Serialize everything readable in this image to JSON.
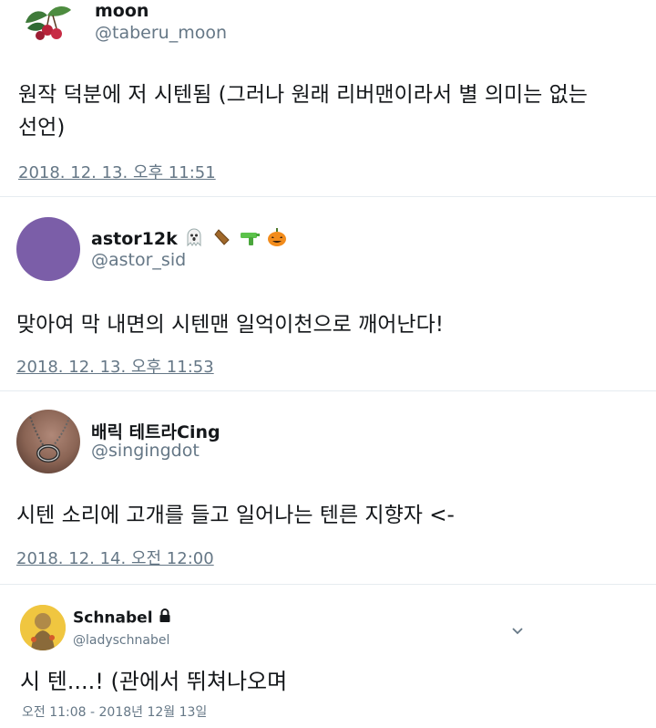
{
  "tweets": [
    {
      "name": "moon",
      "handle": "@taberu_moon",
      "text_line1": "원작 덕분에 저 시텐됨 (그러나 원래 리버맨이라서 별 의미는 없는",
      "text_line2": "선언)",
      "time": "2018. 12. 13. 오후 11:51",
      "avatar_icon": "cherry-leaf-icon"
    },
    {
      "name": "astor12k",
      "handle": "@astor_sid",
      "name_emojis": [
        "ghost-icon",
        "coffin-icon",
        "water-pistol-icon",
        "jack-o-lantern-icon"
      ],
      "text_line1": "맞아여 막 내면의 시텐맨 일억이천으로 깨어난다!",
      "time": "2018. 12. 13. 오후 11:53",
      "avatar_color": "#7b5ea8"
    },
    {
      "name": "배릭 테트라Cing",
      "handle": "@singingdot",
      "text_line1": "시텐 소리에 고개를 들고 일어나는 텐른 지향자 <-",
      "time": "2018. 12. 14. 오전 12:00",
      "avatar_icon": "necklace-photo"
    },
    {
      "name": "Schnabel",
      "handle": "@ladyschnabel",
      "text_line1": "시 텐....! (관에서 뛰쳐나오며",
      "time": "오전 11:08 - 2018년 12월 13일",
      "protected_icon": "lock-icon",
      "menu_icon": "chevron-down-icon"
    }
  ]
}
